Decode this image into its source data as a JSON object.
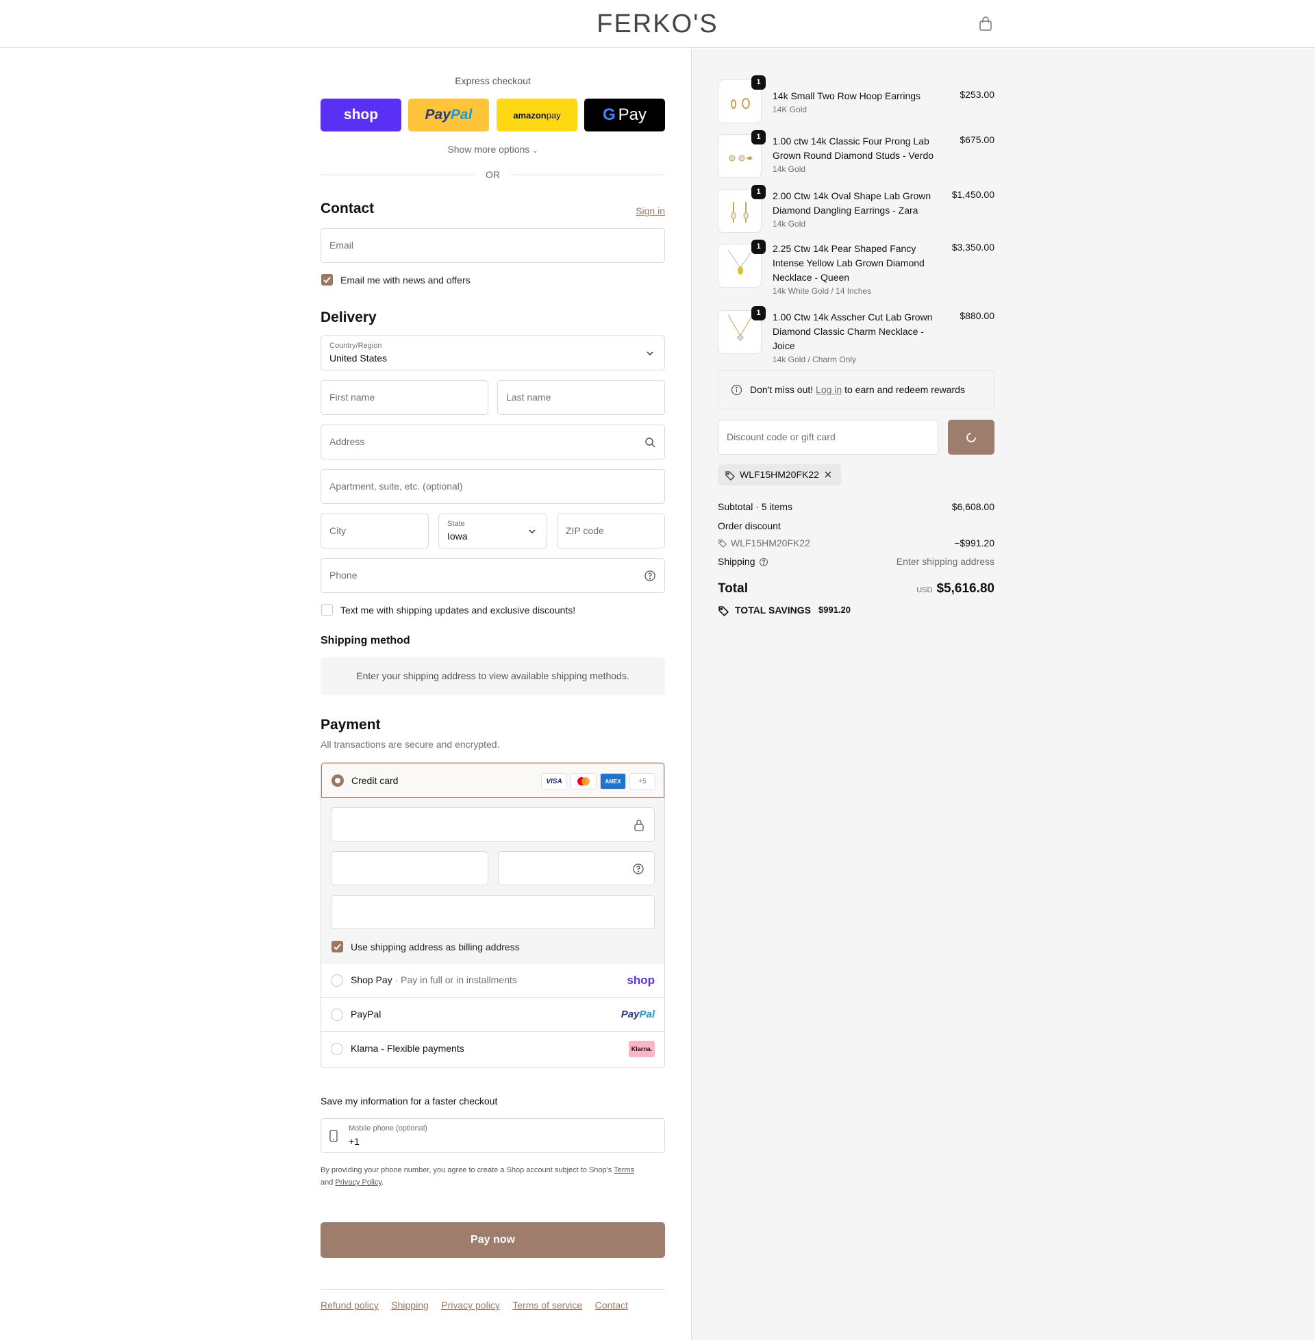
{
  "header": {
    "logo": "FERKO'S",
    "cart_icon": "bag-icon"
  },
  "express": {
    "title": "Express checkout",
    "shop_label": "shop",
    "paypal_a": "Pay",
    "paypal_b": "Pal",
    "amazon_a": "amazon",
    "amazon_b": " pay",
    "gpay_g": "G",
    "gpay_label": "Pay",
    "show_more": "Show more options",
    "or": "OR"
  },
  "contact": {
    "title": "Contact",
    "sign_in": "Sign in",
    "email_placeholder": "Email",
    "news_label": "Email me with news and offers",
    "news_checked": true
  },
  "delivery": {
    "title": "Delivery",
    "country_label": "Country/Region",
    "country_value": "United States",
    "first_name": "First name",
    "last_name": "Last name",
    "address": "Address",
    "apartment": "Apartment, suite, etc. (optional)",
    "city": "City",
    "state_label": "State",
    "state_value": "Iowa",
    "zip": "ZIP code",
    "phone": "Phone",
    "sms_label": "Text me with shipping updates and exclusive discounts!"
  },
  "shipping_method": {
    "title": "Shipping method",
    "info": "Enter your shipping address to view available shipping methods."
  },
  "payment": {
    "title": "Payment",
    "subtitle": "All transactions are secure and encrypted.",
    "credit_card": "Credit card",
    "card_logos": {
      "visa": "VISA",
      "amex": "AMEX",
      "more": "+5"
    },
    "billing_label": "Use shipping address as billing address",
    "shop_pay": "Shop Pay",
    "shop_pay_sub": "Pay in full or in installments",
    "shop_pay_logo": "shop",
    "paypal": "PayPal",
    "paypal_logo_a": "Pay",
    "paypal_logo_b": "Pal",
    "klarna": "Klarna - Flexible payments",
    "klarna_logo": "Klarna.",
    "colors": {
      "accent": "#9e7d6c",
      "shop": "#5a31f4",
      "klarna": "#ffb3c7"
    }
  },
  "save_info": {
    "title": "Save my information for a faster checkout",
    "phone_label": "Mobile phone (optional)",
    "phone_value": "+1",
    "legal_a": "By providing your phone number, you agree to create a Shop account subject to Shop's ",
    "terms": "Terms",
    "legal_b": "and ",
    "privacy": "Privacy Policy",
    "legal_c": "."
  },
  "pay_now": "Pay now",
  "footer": [
    "Refund policy",
    "Shipping",
    "Privacy policy",
    "Terms of service",
    "Contact"
  ],
  "order": {
    "items": [
      {
        "qty": "1",
        "name": "14k Small Two Row Hoop Earrings",
        "variant": "14K Gold",
        "price": "$253.00"
      },
      {
        "qty": "1",
        "name": "1.00 ctw 14k Classic Four Prong Lab Grown Round Diamond Studs - Verdo",
        "variant": "14k Gold",
        "price": "$675.00"
      },
      {
        "qty": "1",
        "name": "2.00 Ctw 14k Oval Shape Lab Grown Diamond Dangling Earrings - Zara",
        "variant": "14k Gold",
        "price": "$1,450.00"
      },
      {
        "qty": "1",
        "name": "2.25 Ctw 14k Pear Shaped Fancy Intense Yellow Lab Grown Diamond Necklace - Queen",
        "variant": "14k White Gold / 14 Inches",
        "price": "$3,350.00"
      },
      {
        "qty": "1",
        "name": "1.00 Ctw 14k Asscher Cut Lab Grown Diamond Classic Charm Necklace - Joice",
        "variant": "14k Gold / Charm Only",
        "price": "$880.00"
      }
    ],
    "reward_a": "Don't miss out! ",
    "reward_link": "Log in",
    "reward_b": " to earn and redeem rewards",
    "discount_placeholder": "Discount code or gift card",
    "applied_code": "WLF15HM20FK22",
    "subtotal_label": "Subtotal · 5 items",
    "subtotal": "$6,608.00",
    "order_discount_label": "Order discount",
    "discount_code": "WLF15HM20FK22",
    "discount_value": "−$991.20",
    "shipping_label": "Shipping",
    "shipping_value": "Enter shipping address",
    "total_label": "Total",
    "currency": "USD",
    "total": "$5,616.80",
    "savings_label": "TOTAL SAVINGS",
    "savings": "$991.20"
  }
}
